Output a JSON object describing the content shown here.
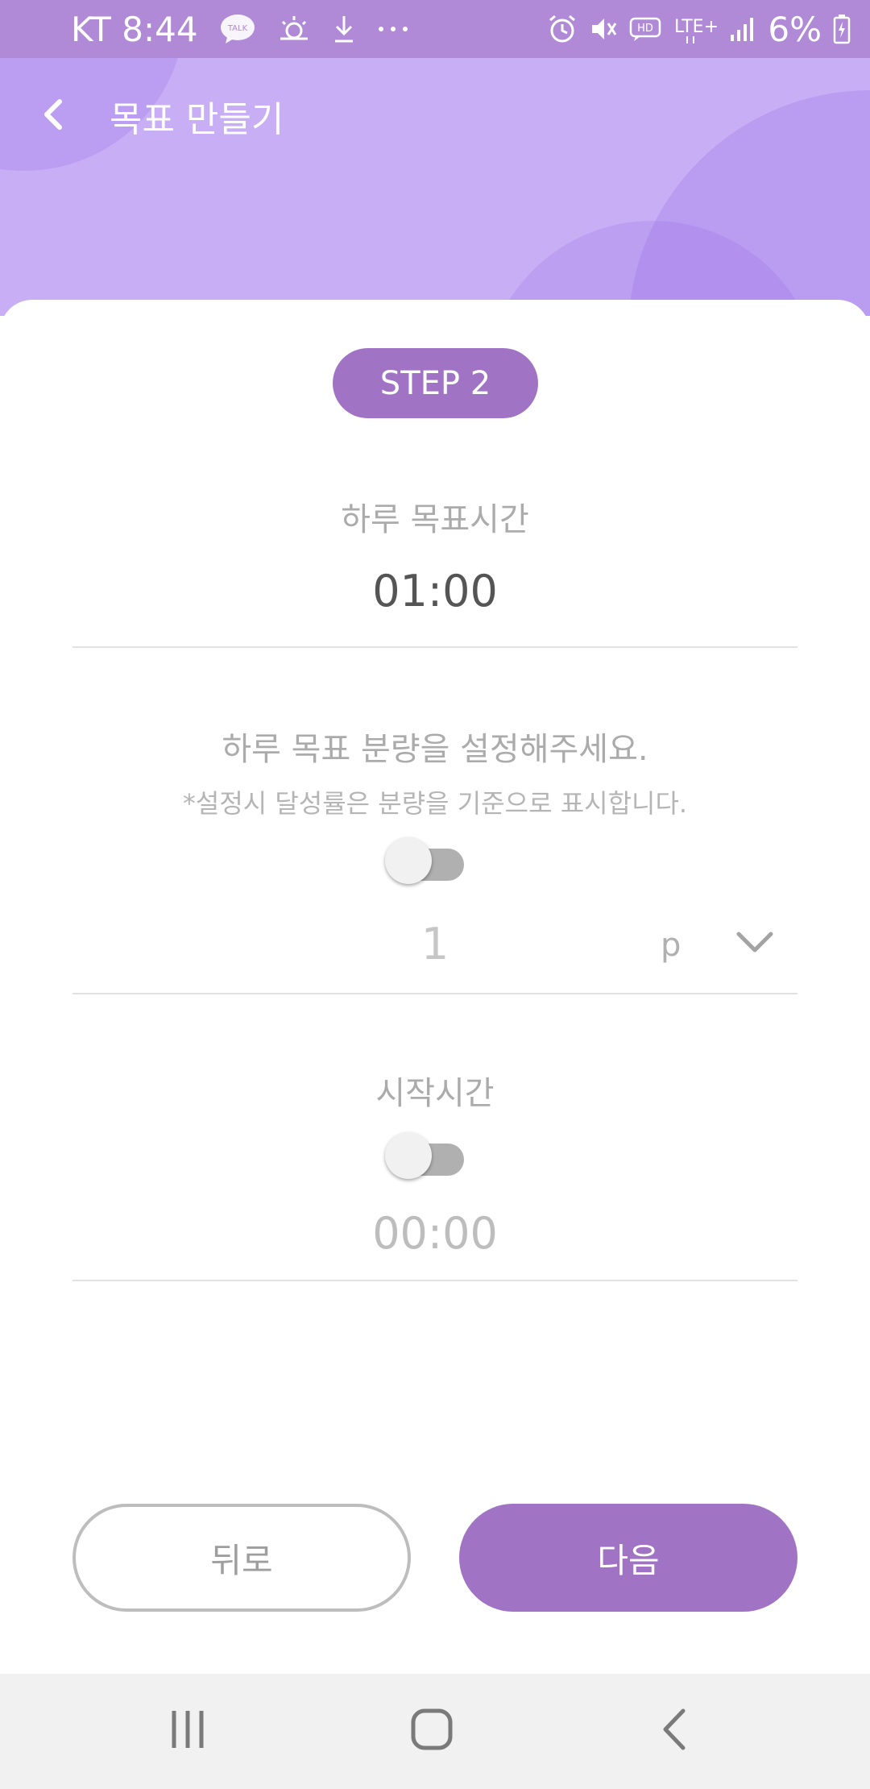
{
  "status_bar": {
    "time_text": "KT 8:44",
    "icons": [
      "kakaotalk-icon",
      "weather-icon",
      "download-icon",
      "more-dots-icon",
      "alarm-icon",
      "mute-icon",
      "hd-icon",
      "lte-plus-icon",
      "signal-icon",
      "battery-charging-icon"
    ],
    "talk_label": "TALK",
    "hd_label": "HD",
    "network_label": "LTE+",
    "battery_text": "6%"
  },
  "header": {
    "title": "목표 만들기",
    "back_icon": "chevron-left-icon"
  },
  "step": {
    "label": "STEP 2"
  },
  "daily_goal_time": {
    "label": "하루 목표시간",
    "value": "01:00"
  },
  "daily_amount": {
    "label": "하루 목표 분량을 설정해주세요.",
    "note": "*설정시 달성률은 분량을 기준으로 표시합니다.",
    "toggle_on": false,
    "value": "1",
    "unit": "p",
    "unit_dropdown_icon": "chevron-down-icon"
  },
  "start_time": {
    "label": "시작시간",
    "toggle_on": false,
    "value": "00:00"
  },
  "buttons": {
    "back_label": "뒤로",
    "next_label": "다음"
  },
  "nav_bar": {
    "icons": [
      "recent-apps-icon",
      "home-icon",
      "back-icon"
    ]
  },
  "colors": {
    "status_bar": "#b08ad6",
    "header_bg": "#c8aef5",
    "accent": "#a173c5",
    "nav_bar_bg": "#f1f1f1"
  }
}
